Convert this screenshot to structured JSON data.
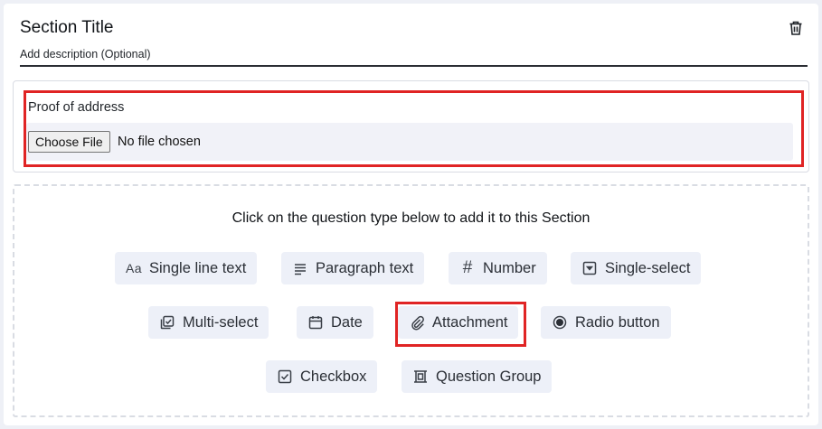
{
  "section": {
    "title": "Section Title",
    "description_placeholder": "Add description (Optional)",
    "delete_icon": "trash-icon"
  },
  "question": {
    "label": "Proof of address",
    "choose_file_label": "Choose File",
    "file_status": "No file chosen"
  },
  "question_types": {
    "heading": "Click on the question type below to add it to this Section",
    "items": [
      {
        "label": "Single line text",
        "icon": "aa-text-icon"
      },
      {
        "label": "Paragraph text",
        "icon": "paragraph-lines-icon"
      },
      {
        "label": "Number",
        "icon": "hash-icon"
      },
      {
        "label": "Single-select",
        "icon": "dropdown-box-icon"
      },
      {
        "label": "Multi-select",
        "icon": "multi-check-icon"
      },
      {
        "label": "Date",
        "icon": "calendar-icon"
      },
      {
        "label": "Attachment",
        "icon": "paperclip-icon"
      },
      {
        "label": "Radio button",
        "icon": "radio-icon"
      },
      {
        "label": "Checkbox",
        "icon": "checkbox-icon"
      },
      {
        "label": "Question Group",
        "icon": "group-frame-icon"
      }
    ]
  },
  "colors": {
    "highlight": "#e02424",
    "chip_background": "#edf0f8",
    "page_background": "#eef0f6"
  }
}
